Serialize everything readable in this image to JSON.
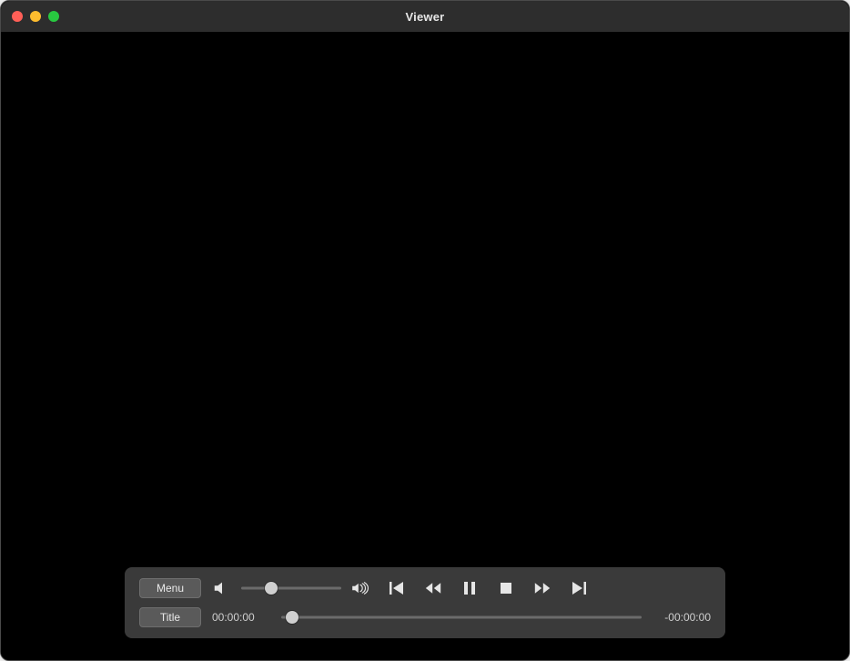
{
  "window": {
    "title": "Viewer"
  },
  "controls": {
    "menu_label": "Menu",
    "title_label": "Title",
    "volume": {
      "percent": 30
    },
    "time": {
      "elapsed": "00:00:00",
      "remaining": "-00:00:00",
      "position_percent": 3
    }
  }
}
